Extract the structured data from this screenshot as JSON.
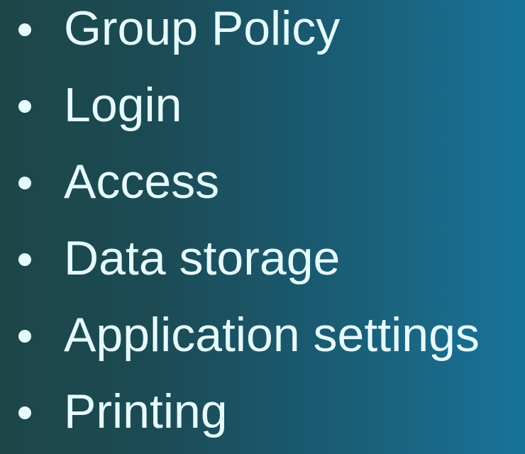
{
  "slide": {
    "bullets": [
      "Group Policy",
      "Login",
      "Access",
      "Data storage",
      "Application settings",
      "Printing"
    ]
  },
  "colors": {
    "text": "#e6fbff",
    "background_left": "#1d4648",
    "background_right": "#197399"
  }
}
